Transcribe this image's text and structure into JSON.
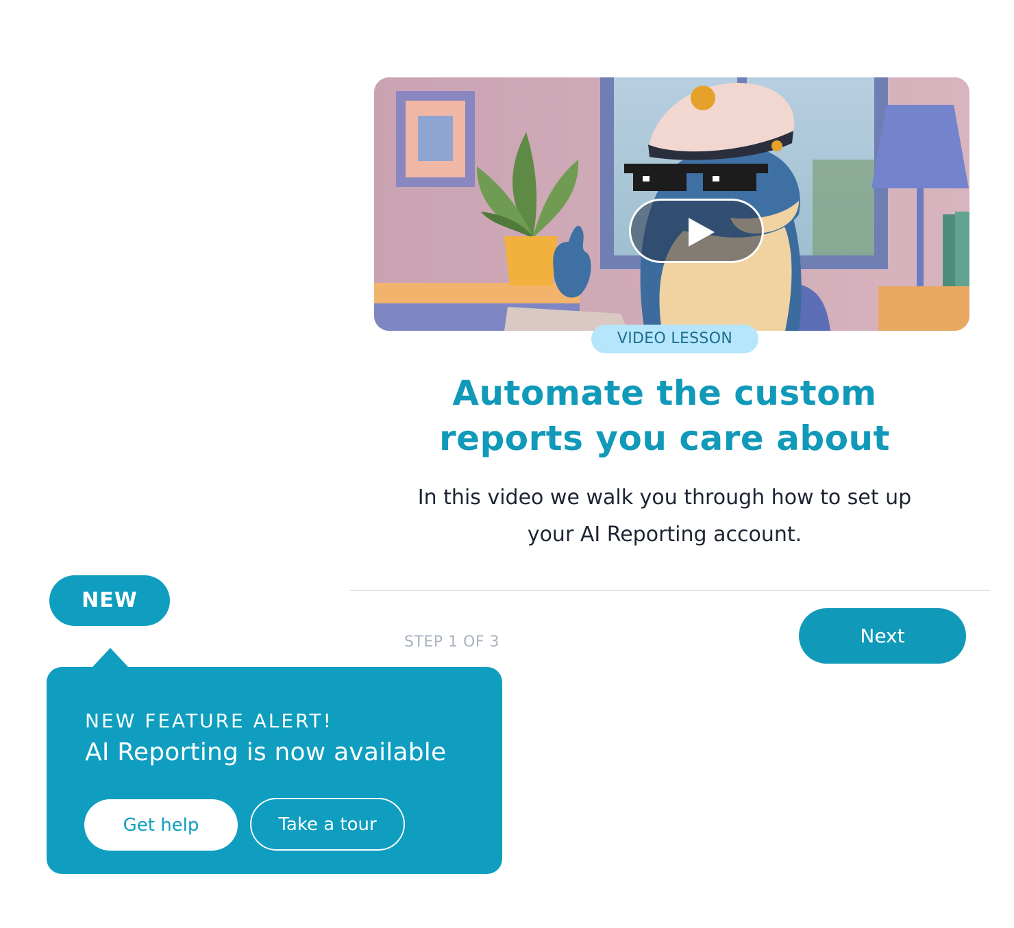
{
  "card": {
    "video": {
      "thumbnail": "cartoon-dolphin-captain-thumbs-up",
      "play_icon": "play-icon"
    },
    "badge": "VIDEO LESSON",
    "title": "Automate the custom reports you care about",
    "description": "In this video we walk you through how to set up your AI Reporting account.",
    "step": "STEP 1 OF 3",
    "next_label": "Next"
  },
  "alert": {
    "badge": "NEW",
    "eyebrow": "NEW FEATURE ALERT!",
    "headline": "AI Reporting is now available",
    "help_label": "Get help",
    "tour_label": "Take a tour"
  },
  "colors": {
    "primary": "#1199b9",
    "badge_bg": "#b5e6fb",
    "badge_text": "#1c6e8c",
    "body_text": "#1d2433",
    "muted": "#a9b3c2"
  }
}
